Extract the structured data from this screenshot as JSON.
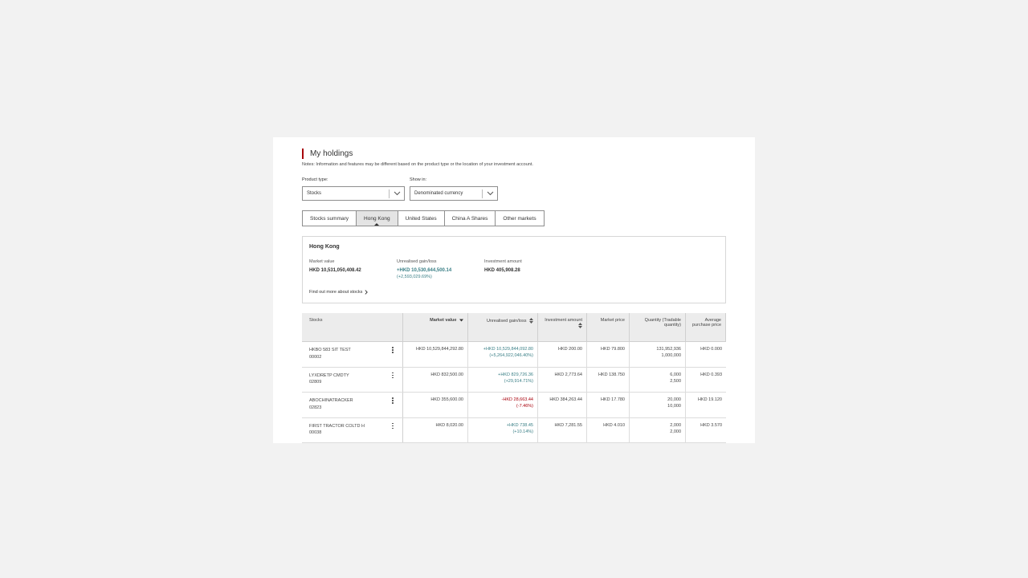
{
  "page": {
    "title": "My holdings",
    "notes": "Notes: Information and features may be different based on the product type or the location of your investment account."
  },
  "filters": {
    "product_type_label": "Product type:",
    "product_type_value": "Stocks",
    "show_in_label": "Show in:",
    "show_in_value": "Denominated currency"
  },
  "tabs": [
    {
      "label": "Stocks summary",
      "active": false
    },
    {
      "label": "Hong Kong",
      "active": true
    },
    {
      "label": "United States",
      "active": false
    },
    {
      "label": "China A Shares",
      "active": false
    },
    {
      "label": "Other markets",
      "active": false
    }
  ],
  "summary": {
    "title": "Hong Kong",
    "market_value_label": "Market value",
    "market_value": "HKD 10,531,050,408.42",
    "gain_label": "Unrealised gain/loss",
    "gain_value": "+HKD 10,530,644,500.14",
    "gain_pct": "(+2,593,029.69%)",
    "invest_label": "Investment amount",
    "invest_value": "HKD 405,908.28",
    "find_more": "Find out more about stocks"
  },
  "table": {
    "headers": {
      "stocks": "Stocks",
      "market_value": "Market value",
      "gain": "Unrealised gain/loss",
      "invest": "Investment amount",
      "price": "Market price",
      "quantity": "Quantity (Tradable quantity)",
      "avg_price": "Average purchase price"
    },
    "rows": [
      {
        "name": "HKBO 583 SIT TEST",
        "code": "00002",
        "market_value": "HKD 10,529,844,292.80",
        "gain": "+HKD 10,529,844,092.80",
        "gain_pct": "(+5,264,922,046.40%)",
        "gain_dir": "gain",
        "invest": "HKD 200.00",
        "price": "HKD 79.800",
        "qty": "131,952,936",
        "qty_tradable": "1,000,000",
        "avg": "HKD 0.000"
      },
      {
        "name": "LYXDRETP CMDTY",
        "code": "02809",
        "market_value": "HKD 832,500.00",
        "gain": "+HKD 829,726.36",
        "gain_pct": "(+29,914.71%)",
        "gain_dir": "gain",
        "invest": "HKD 2,773.64",
        "price": "HKD 138.750",
        "qty": "6,000",
        "qty_tradable": "2,500",
        "avg": "HKD 0.393"
      },
      {
        "name": "ABOCHINATRACKER",
        "code": "02823",
        "market_value": "HKD 355,600.00",
        "gain": "-HKD 28,663.44",
        "gain_pct": "(-7.46%)",
        "gain_dir": "loss",
        "invest": "HKD 384,263.44",
        "price": "HKD 17.780",
        "qty": "20,000",
        "qty_tradable": "10,000",
        "avg": "HKD 19.120"
      },
      {
        "name": "FIRST TRACTOR COLTD H",
        "code": "00038",
        "market_value": "HKD 8,020.00",
        "gain": "+HKD 738.45",
        "gain_pct": "(+10.14%)",
        "gain_dir": "gain",
        "invest": "HKD 7,281.55",
        "price": "HKD 4.010",
        "qty": "2,000",
        "qty_tradable": "2,000",
        "avg": "HKD 3.570"
      }
    ]
  },
  "colors": {
    "accent": "#a8000b",
    "gain": "#3a7f86",
    "loss": "#a8000b"
  },
  "icons": [
    "chevron-down-icon",
    "sort-desc-icon",
    "sort-both-icon",
    "chevron-right-icon",
    "more-vertical-icon"
  ]
}
